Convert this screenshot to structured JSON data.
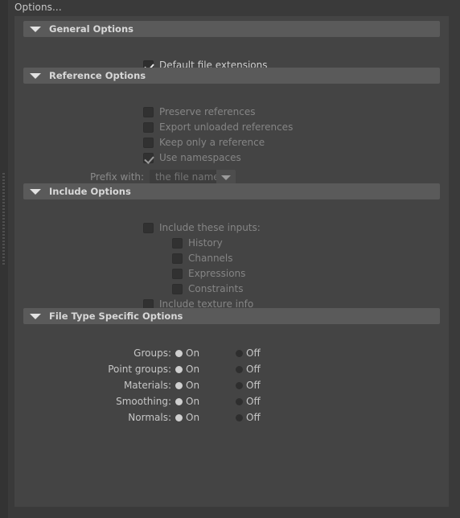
{
  "window": {
    "title": "Options...",
    "colors": {
      "app_background": "#333333",
      "panel_background": "#444444",
      "section_header": "#5a5a5a",
      "text": "#cfcfcf",
      "text_disabled": "#858585",
      "checkbox_fill": "#2e2e2e",
      "radio_selected": "#cfcfcf",
      "radio_unselected": "#2e2e2e"
    }
  },
  "sections": [
    {
      "id": "general-options",
      "title": "General Options",
      "collapse_icon": "triangle-down-icon",
      "expanded": true,
      "checkboxes": [
        {
          "label": "Default file extensions",
          "checked": true,
          "disabled": false
        }
      ]
    },
    {
      "id": "reference-options",
      "title": "Reference Options",
      "collapse_icon": "triangle-down-icon",
      "expanded": true,
      "checkboxes": [
        {
          "label": "Preserve references",
          "checked": false,
          "disabled": true
        },
        {
          "label": "Export unloaded references",
          "checked": false,
          "disabled": true
        },
        {
          "label": "Keep only a reference",
          "checked": false,
          "disabled": true
        },
        {
          "label": "Use namespaces",
          "checked": true,
          "disabled": true
        }
      ],
      "combo": {
        "caption": "Prefix with:",
        "value": "the file name",
        "disabled": true,
        "arrow_icon": "triangle-down-icon"
      }
    },
    {
      "id": "include-options",
      "title": "Include Options",
      "collapse_icon": "triangle-down-icon",
      "expanded": true,
      "checkboxes": [
        {
          "label": "Include these inputs:",
          "checked": false,
          "disabled": true,
          "indent": 0
        },
        {
          "label": "History",
          "checked": false,
          "disabled": true,
          "indent": 1
        },
        {
          "label": "Channels",
          "checked": false,
          "disabled": true,
          "indent": 1
        },
        {
          "label": "Expressions",
          "checked": false,
          "disabled": true,
          "indent": 1
        },
        {
          "label": "Constraints",
          "checked": false,
          "disabled": true,
          "indent": 1
        },
        {
          "label": "Include texture info",
          "checked": false,
          "disabled": true,
          "indent": 0
        }
      ]
    },
    {
      "id": "file-type-specific-options",
      "title": "File Type Specific Options",
      "collapse_icon": "triangle-down-icon",
      "expanded": true,
      "radio_rows": [
        {
          "caption": "Groups:",
          "options": [
            "On",
            "Off"
          ],
          "selected": "On"
        },
        {
          "caption": "Point groups:",
          "options": [
            "On",
            "Off"
          ],
          "selected": "On"
        },
        {
          "caption": "Materials:",
          "options": [
            "On",
            "Off"
          ],
          "selected": "On"
        },
        {
          "caption": "Smoothing:",
          "options": [
            "On",
            "Off"
          ],
          "selected": "On"
        },
        {
          "caption": "Normals:",
          "options": [
            "On",
            "Off"
          ],
          "selected": "On"
        }
      ]
    }
  ]
}
